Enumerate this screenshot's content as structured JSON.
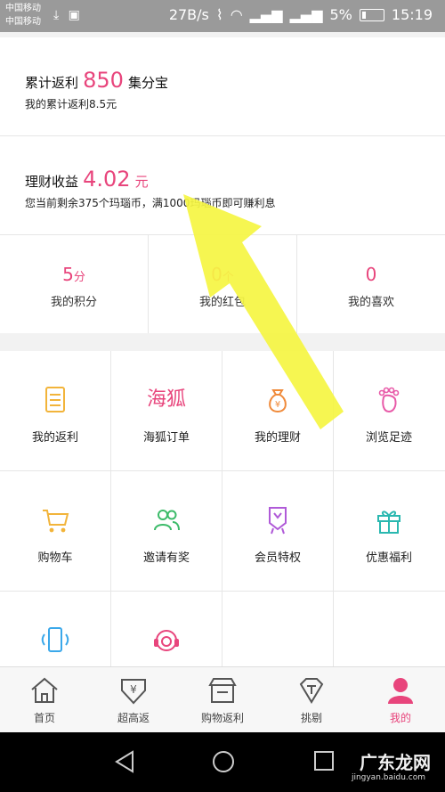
{
  "status_bar": {
    "carrier_1": "中国移动",
    "carrier_2": "中国移动",
    "speed": "27B/s",
    "battery": "5%",
    "time": "15:19"
  },
  "rebate": {
    "label": "累计返利",
    "amount": "850",
    "unit": "集分宝",
    "sub": "我的累计返利8.5元"
  },
  "finance": {
    "label": "理财收益",
    "amount": "4.02",
    "unit": "元",
    "sub": "您当前剩余375个玛瑙币，满1000玛瑙币即可赚利息"
  },
  "stats": [
    {
      "value": "5",
      "unit": "分",
      "label": "我的积分"
    },
    {
      "value": "0",
      "unit": "个",
      "label": "我的红包"
    },
    {
      "value": "0",
      "unit": "",
      "label": "我的喜欢"
    }
  ],
  "grid": [
    {
      "label": "我的返利",
      "icon": "document-icon",
      "color": "#f2b43a"
    },
    {
      "label": "海狐订单",
      "icon": "haihu-logo-icon",
      "icon_text": "海狐",
      "color": "#e8457c"
    },
    {
      "label": "我的理财",
      "icon": "money-bag-icon",
      "color": "#f08a3a"
    },
    {
      "label": "浏览足迹",
      "icon": "footprint-icon",
      "color": "#e85aa8"
    },
    {
      "label": "购物车",
      "icon": "cart-icon",
      "color": "#f2b43a"
    },
    {
      "label": "邀请有奖",
      "icon": "people-icon",
      "color": "#3dbb6a"
    },
    {
      "label": "会员特权",
      "icon": "badge-icon",
      "color": "#b05ad8"
    },
    {
      "label": "优惠福利",
      "icon": "gift-icon",
      "color": "#2ab8b0"
    },
    {
      "label": "",
      "icon": "phone-icon",
      "color": "#3aa8ea"
    },
    {
      "label": "",
      "icon": "headset-icon",
      "color": "#e8457c"
    }
  ],
  "bottom_nav": [
    {
      "label": "首页",
      "icon": "home-icon"
    },
    {
      "label": "超高返",
      "icon": "yen-arrow-icon"
    },
    {
      "label": "购物返利",
      "icon": "shop-icon"
    },
    {
      "label": "挑剔",
      "icon": "diamond-icon"
    },
    {
      "label": "我的",
      "icon": "user-icon"
    }
  ],
  "watermark": {
    "text": "广东龙网",
    "sub": "jingyan.baidu.com"
  }
}
